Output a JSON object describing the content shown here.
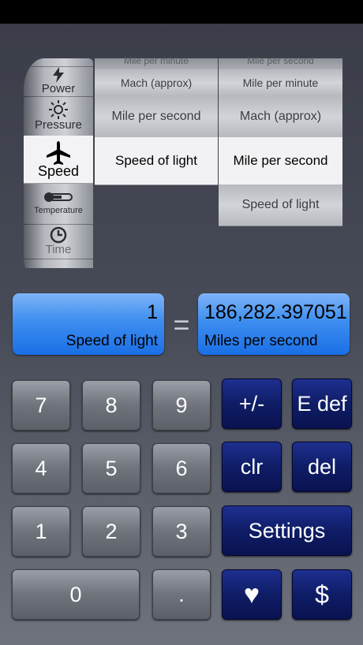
{
  "picker": {
    "categories": [
      {
        "label": "Power",
        "icon": "lightning-icon"
      },
      {
        "label": "Pressure",
        "icon": "gauge-sun-icon"
      },
      {
        "label": "Speed",
        "icon": "airplane-icon",
        "selected": true
      },
      {
        "label": "Temperature",
        "icon": "thermometer-icon"
      },
      {
        "label": "Time",
        "icon": "clock-icon"
      }
    ],
    "from_units": [
      "Mile per minute",
      "Mach (approx)",
      "Mile per second",
      "Speed of light"
    ],
    "to_units": [
      "Mile per second",
      "Mile per minute",
      "Mach (approx)",
      "Mile per second",
      "Speed of light"
    ]
  },
  "input": {
    "value": "1",
    "unit": "Speed of light"
  },
  "equals": "=",
  "output": {
    "value": "186,282.397051",
    "unit": "Miles per second"
  },
  "keys": {
    "k7": "7",
    "k8": "8",
    "k9": "9",
    "sign": "+/-",
    "edef": "E def",
    "k4": "4",
    "k5": "5",
    "k6": "6",
    "clr": "clr",
    "del": "del",
    "k1": "1",
    "k2": "2",
    "k3": "3",
    "settings": "Settings",
    "k0": "0",
    "dot": ".",
    "heart": "♥",
    "dollar": "$"
  }
}
